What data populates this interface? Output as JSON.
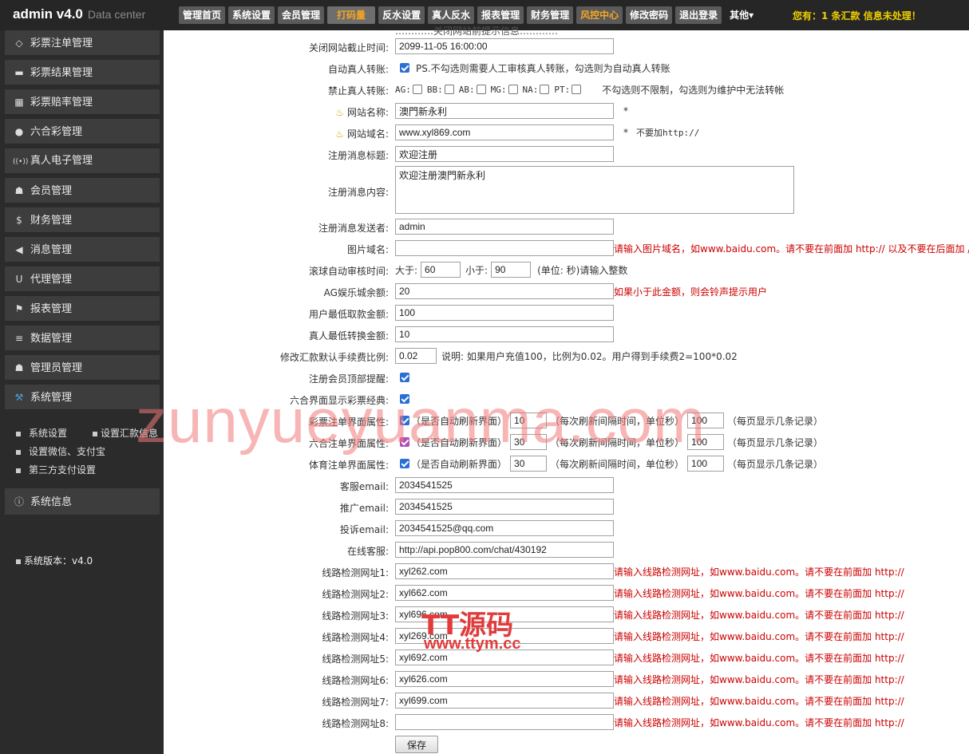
{
  "header": {
    "brand": "admin v4.0",
    "brand_sub": "Data center",
    "nav": [
      "管理首页",
      "系统设置",
      "会员管理",
      "打码量",
      "反水设置",
      "真人反水",
      "报表管理",
      "财务管理",
      "风控中心",
      "修改密码",
      "退出登录"
    ],
    "other": "其他▾",
    "notice": "您有：1 条汇款 信息未处理！"
  },
  "sidebar": {
    "items": [
      {
        "icon": "tag-icon",
        "glyph": "◇",
        "label": "彩票注单管理"
      },
      {
        "icon": "briefcase-icon",
        "glyph": "▬",
        "label": "彩票结果管理"
      },
      {
        "icon": "calendar-icon",
        "glyph": "▦",
        "label": "彩票赔率管理"
      },
      {
        "icon": "drop-icon",
        "glyph": "●",
        "label": "六合彩管理"
      },
      {
        "icon": "broadcast-icon",
        "glyph": "((•))",
        "label": "真人电子管理"
      },
      {
        "icon": "user-icon",
        "glyph": "☗",
        "label": "会员管理"
      },
      {
        "icon": "dollar-icon",
        "glyph": "$",
        "label": "财务管理"
      },
      {
        "icon": "megaphone-icon",
        "glyph": "◀",
        "label": "消息管理"
      },
      {
        "icon": "magnet-icon",
        "glyph": "U",
        "label": "代理管理"
      },
      {
        "icon": "flag-icon",
        "glyph": "⚑",
        "label": "报表管理"
      },
      {
        "icon": "database-icon",
        "glyph": "≡",
        "label": "数据管理"
      },
      {
        "icon": "admin-icon",
        "glyph": "☗",
        "label": "管理员管理"
      },
      {
        "icon": "wrench-icon",
        "glyph": "⚒",
        "label": "系统管理"
      }
    ],
    "sub_items": [
      "系统设置",
      "设置汇款信息",
      "设置微信、支付宝",
      "第三方支付设置"
    ],
    "system_info": "系统信息",
    "version": "系统版本：v4.0"
  },
  "form": {
    "top_cut": "…………关闭网站前提示信息…………",
    "close_time": {
      "label": "关闭网站截止时间:",
      "value": "2099-11-05 16:00:00"
    },
    "auto_transfer": {
      "label": "自动真人转账:",
      "hint": "PS.不勾选则需要人工审核真人转账，勾选则为自动真人转账"
    },
    "ban_transfer": {
      "label": "禁止真人转账:",
      "platforms": [
        "AG:",
        "BB:",
        "AB:",
        "MG:",
        "NA:",
        "PT:"
      ],
      "hint": "不勾选则不限制，勾选则为维护中无法转帐"
    },
    "site_name": {
      "label": "网站名称:",
      "value": "澳門新永利",
      "star": "*"
    },
    "site_domain": {
      "label": "网站域名:",
      "value": "www.xyl869.com",
      "star": "*",
      "hint": "不要加http://"
    },
    "reg_title": {
      "label": "注册消息标题:",
      "value": "欢迎注册"
    },
    "reg_content": {
      "label": "注册消息内容:",
      "value": "欢迎注册澳門新永利"
    },
    "reg_sender": {
      "label": "注册消息发送者:",
      "value": "admin"
    },
    "img_domain": {
      "label": "图片域名:",
      "value": "",
      "hint": "请输入图片域名，如www.baidu.com。请不要在前面加 http:// 以及不要在后面加 /"
    },
    "auto_audit": {
      "label": "滚球自动审核时间:",
      "gt": "大于:",
      "gt_val": "60",
      "lt": "小于:",
      "lt_val": "90",
      "hint": "(单位: 秒)请输入整数"
    },
    "ag_balance": {
      "label": "AG娱乐城余额:",
      "value": "20",
      "hint": "如果小于此金额，则会铃声提示用户"
    },
    "min_withdraw": {
      "label": "用户最低取款金额:",
      "value": "100"
    },
    "min_transfer": {
      "label": "真人最低转换金额:",
      "value": "10"
    },
    "fee_ratio": {
      "label": "修改汇款默认手续费比例:",
      "value": "0.02",
      "hint": "说明: 如果用户充值100，比例为0.02。用户得到手续费2=100*0.02"
    },
    "reg_top_alert": {
      "label": "注册会员顶部提醒:"
    },
    "lhc_classic": {
      "label": "六合界面显示彩票经典:"
    },
    "refresh_rows": [
      {
        "label": "彩票注单界面属性:",
        "t1": "（是否自动刷新界面）",
        "interval": "10",
        "t2": "（每次刷新间隔时间，单位秒）",
        "per_page": "100",
        "t3": "（每页显示几条记录）"
      },
      {
        "label": "六合注单界面属性:",
        "t1": "（是否自动刷新界面）",
        "interval": "30",
        "t2": "（每次刷新间隔时间，单位秒）",
        "per_page": "100",
        "t3": "（每页显示几条记录）"
      },
      {
        "label": "体育注单界面属性:",
        "t1": "（是否自动刷新界面）",
        "interval": "30",
        "t2": "（每次刷新间隔时间，单位秒）",
        "per_page": "100",
        "t3": "（每页显示几条记录）"
      }
    ],
    "service_email": {
      "label": "客服email:",
      "value": "2034541525"
    },
    "promo_email": {
      "label": "推广email:",
      "value": "2034541525"
    },
    "complaint_email": {
      "label": "投诉email:",
      "value": "2034541525@qq.com"
    },
    "online_service": {
      "label": "在线客服:",
      "value": "http://api.pop800.com/chat/430192"
    },
    "lines": [
      {
        "label": "线路检测网址1:",
        "value": "xyl262.com"
      },
      {
        "label": "线路检测网址2:",
        "value": "xyl662.com"
      },
      {
        "label": "线路检测网址3:",
        "value": "xyl696.com"
      },
      {
        "label": "线路检测网址4:",
        "value": "xyl269.com"
      },
      {
        "label": "线路检测网址5:",
        "value": "xyl692.com"
      },
      {
        "label": "线路检测网址6:",
        "value": "xyl626.com"
      },
      {
        "label": "线路检测网址7:",
        "value": "xyl699.com"
      },
      {
        "label": "线路检测网址8:",
        "value": ""
      }
    ],
    "line_hint": "请输入线路检测网址，如www.baidu.com。请不要在前面加 http://",
    "save": "保存"
  },
  "watermarks": {
    "main": "zunyueyuanma.com",
    "logo": "TT源码",
    "site": "www.ttym.cc"
  }
}
